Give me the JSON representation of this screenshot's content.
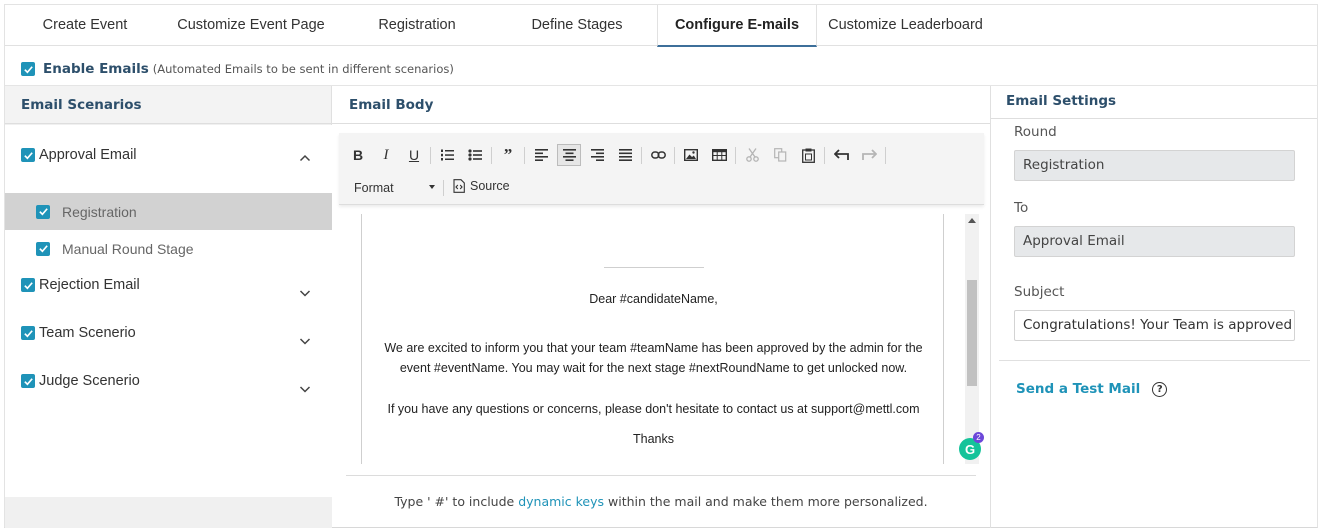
{
  "tabs": [
    {
      "label": "Create Event"
    },
    {
      "label": "Customize Event Page"
    },
    {
      "label": "Registration"
    },
    {
      "label": "Define Stages"
    },
    {
      "label": "Configure E-mails"
    },
    {
      "label": "Customize Leaderboard"
    }
  ],
  "active_tab": "Configure E-mails",
  "enable_emails": {
    "checked": true,
    "label": "Enable Emails",
    "note": "(Automated Emails to be sent in different scenarios)"
  },
  "scenarios": {
    "heading": "Email Scenarios",
    "items": [
      {
        "label": "Approval Email",
        "checked": true,
        "expanded": true,
        "children": [
          {
            "label": "Registration",
            "checked": true,
            "selected": true
          },
          {
            "label": "Manual Round Stage",
            "checked": true,
            "selected": false
          }
        ]
      },
      {
        "label": "Rejection Email",
        "checked": true,
        "expanded": false
      },
      {
        "label": "Team Scenerio",
        "checked": true,
        "expanded": false
      },
      {
        "label": "Judge Scenerio",
        "checked": true,
        "expanded": false
      }
    ]
  },
  "email_body": {
    "heading": "Email Body",
    "toolbar": {
      "format_label": "Format",
      "source_label": "Source",
      "buttons": [
        "bold",
        "italic",
        "underline",
        "numbered-list",
        "bulleted-list",
        "blockquote",
        "align-left",
        "align-center",
        "align-right",
        "justify",
        "link",
        "image",
        "table",
        "cut",
        "copy",
        "paste",
        "undo",
        "redo"
      ]
    },
    "content": {
      "greeting": "Dear #candidateName,",
      "paragraph": "We are excited to inform you that your team #teamName has been approved by the admin for the event #eventName. You may wait for the next stage #nextRoundName to get unlocked now.",
      "contact": "If you have any questions or concerns, please don't hesitate to contact us at support@mettl.com",
      "closing": "Thanks"
    },
    "grammarly_count": "2",
    "hint": {
      "prefix": "Type ' #' to include",
      "link": "dynamic keys",
      "suffix": "within the mail and make them more personalized."
    }
  },
  "email_settings": {
    "heading": "Email Settings",
    "round_label": "Round",
    "round_value": "Registration",
    "to_label": "To",
    "to_value": "Approval Email",
    "subject_label": "Subject",
    "subject_value": "Congratulations! Your Team is approved",
    "test_mail_label": "Send a Test Mail"
  },
  "colors": {
    "accent": "#1f93b8",
    "heading": "#2d4f6b",
    "selected_row": "#d2d2d2",
    "active_tab_underline": "#3d6f9a"
  }
}
